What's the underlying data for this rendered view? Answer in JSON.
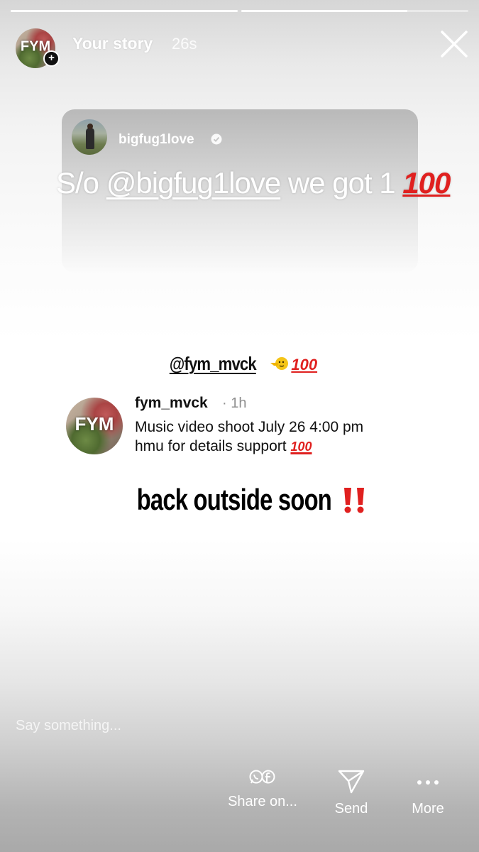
{
  "progress": [
    {
      "fill": 1.0
    },
    {
      "fill": 0.73
    }
  ],
  "header": {
    "avatar_text": "FYM",
    "title": "Your story",
    "time": "26s"
  },
  "shared_story": {
    "username": "bigfug1love",
    "shoutout_prefix": "S/o ",
    "shoutout_mention": "@bigfug1love",
    "shoutout_suffix": " we got 1 ",
    "shoutout_emoji": "100"
  },
  "mention_sticker": {
    "text": "@fym_mvck",
    "emoji": "100"
  },
  "post": {
    "avatar_text": "FYM",
    "username": "fym_mvck",
    "time": "· 1h",
    "line1": "Music video shoot July 26 4:00 pm",
    "line2": "hmu for details support ",
    "emoji": "100"
  },
  "caption": {
    "text": "back outside soon"
  },
  "bottom": {
    "placeholder": "Say something...",
    "actions": [
      {
        "label": "Share on...",
        "icon": "share-icon"
      },
      {
        "label": "Send",
        "icon": "send-icon"
      },
      {
        "label": "More",
        "icon": "more-icon"
      }
    ]
  },
  "colors": {
    "hundred_red": "#e0201f",
    "text_white": "#ffffff"
  }
}
